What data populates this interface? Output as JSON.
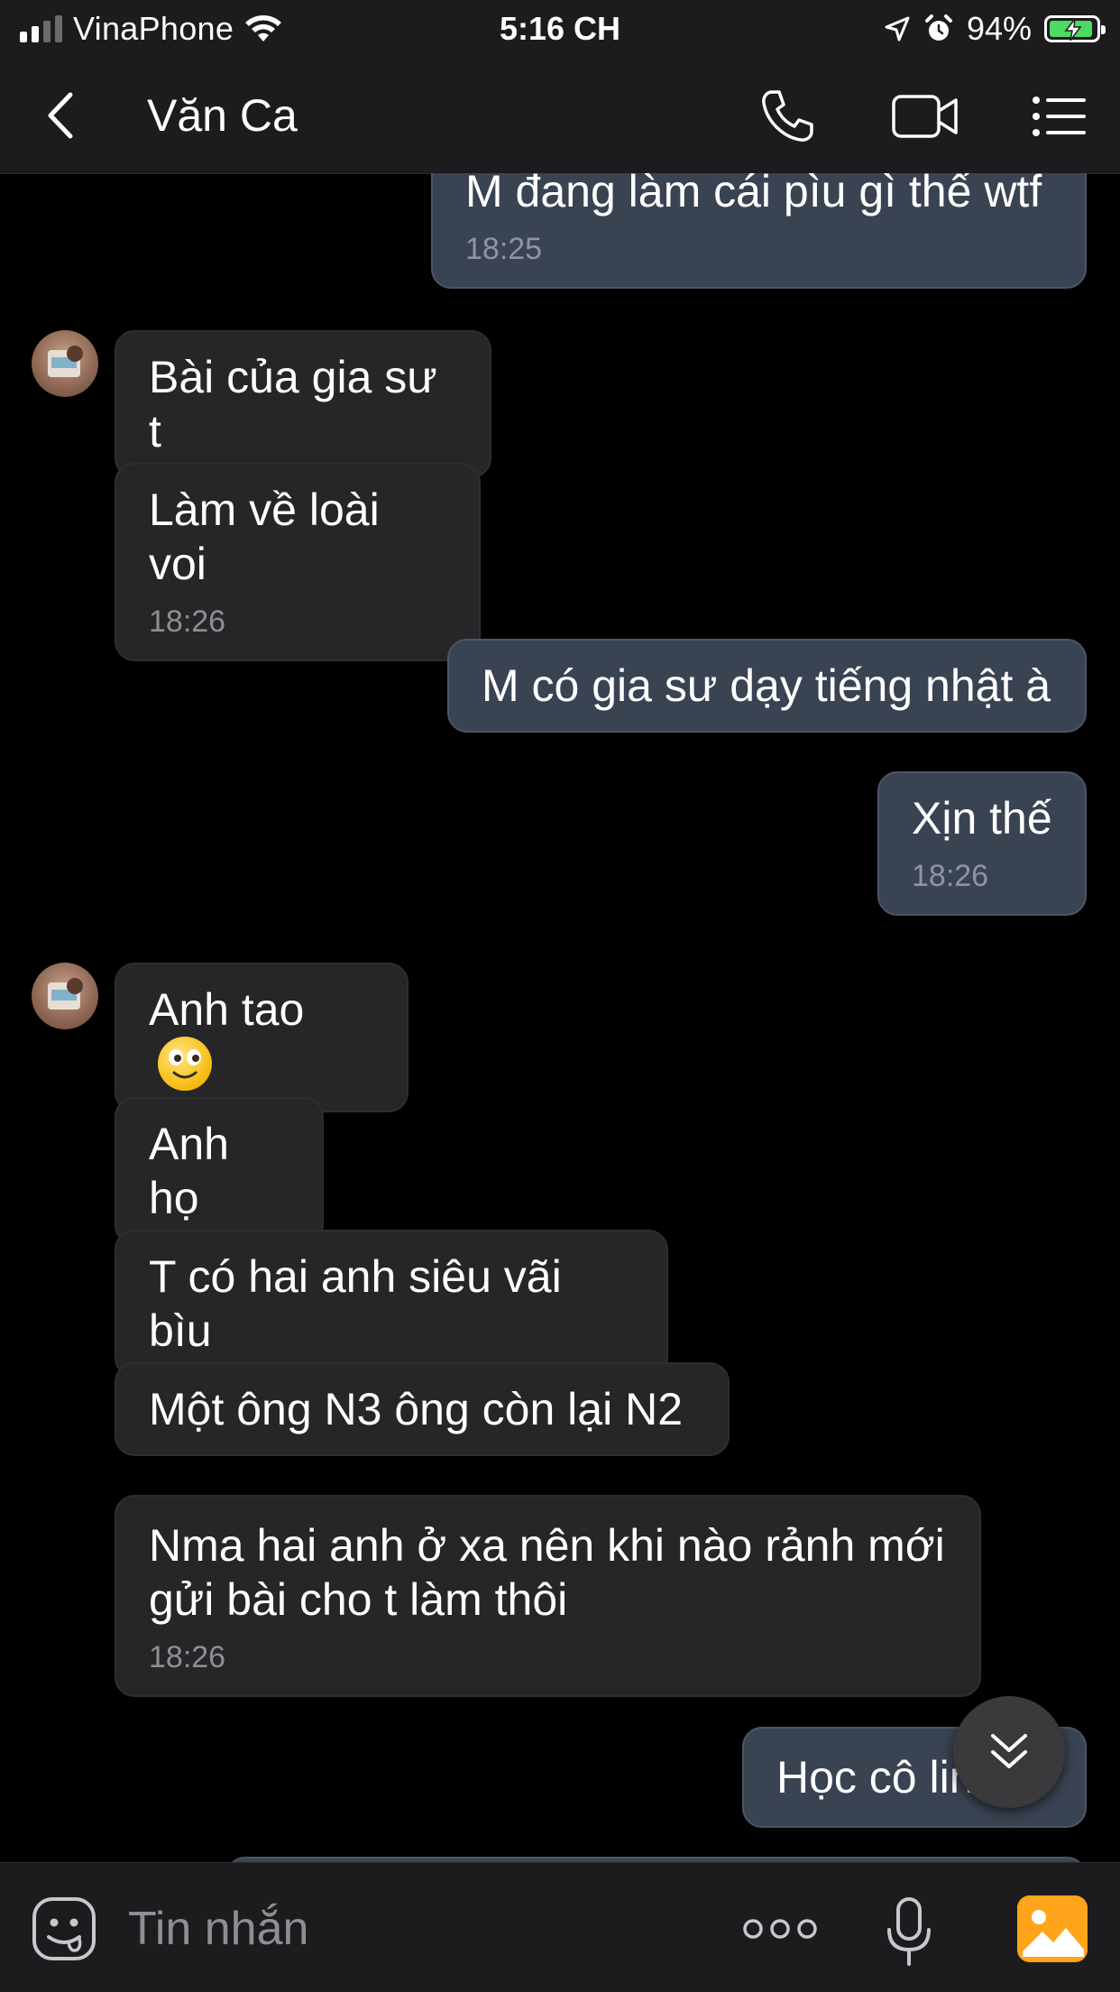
{
  "status_bar": {
    "carrier": "VinaPhone",
    "time": "5:16 CH",
    "battery": "94%",
    "battery_level": 0.94,
    "icons": [
      "signal-icon",
      "wifi-icon",
      "location-icon",
      "alarm-icon",
      "battery-charging-icon"
    ]
  },
  "header": {
    "contact_name": "Văn Ca",
    "icons": [
      "back-chevron-icon",
      "phone-icon",
      "video-camera-icon",
      "menu-list-icon"
    ]
  },
  "messages": [
    {
      "side": "out",
      "text": "M đang làm cái pìu gì thế wtf",
      "time": "18:25"
    },
    {
      "side": "in",
      "text": "Bài của gia sư t",
      "time": ""
    },
    {
      "side": "in",
      "text": "Làm về loài voi",
      "time": "18:26"
    },
    {
      "side": "out",
      "text": "M có gia sư dạy tiếng nhật à",
      "time": ""
    },
    {
      "side": "out",
      "text": "Xịn thế",
      "time": "18:26"
    },
    {
      "side": "in",
      "text": "Anh tao",
      "time": "",
      "emoji": "slightly-smiling-face-icon"
    },
    {
      "side": "in",
      "text": "Anh họ",
      "time": ""
    },
    {
      "side": "in",
      "text": "T có hai anh siêu vãi bìu",
      "time": ""
    },
    {
      "side": "in",
      "text": "Một ông N3 ông còn lại N2",
      "time": ""
    },
    {
      "side": "in",
      "text": "Nma hai anh ở xa nên khi nào rảnh mới gửi bài cho t làm thôi",
      "time": "18:26"
    },
    {
      "side": "out",
      "text": "Học cô linh đi",
      "time": ""
    }
  ],
  "input_bar": {
    "placeholder": "Tin nhắn",
    "icons": [
      "emoji-icon",
      "more-dots-icon",
      "microphone-icon",
      "photo-icon"
    ]
  },
  "colors": {
    "background": "#000000",
    "bar": "#1c1c1e",
    "incoming_bubble": "#262628",
    "outgoing_bubble": "#3a4352",
    "timestamp": "#8e8e93",
    "accent_photo": "#ffa41b",
    "battery_green": "#4cd964"
  }
}
